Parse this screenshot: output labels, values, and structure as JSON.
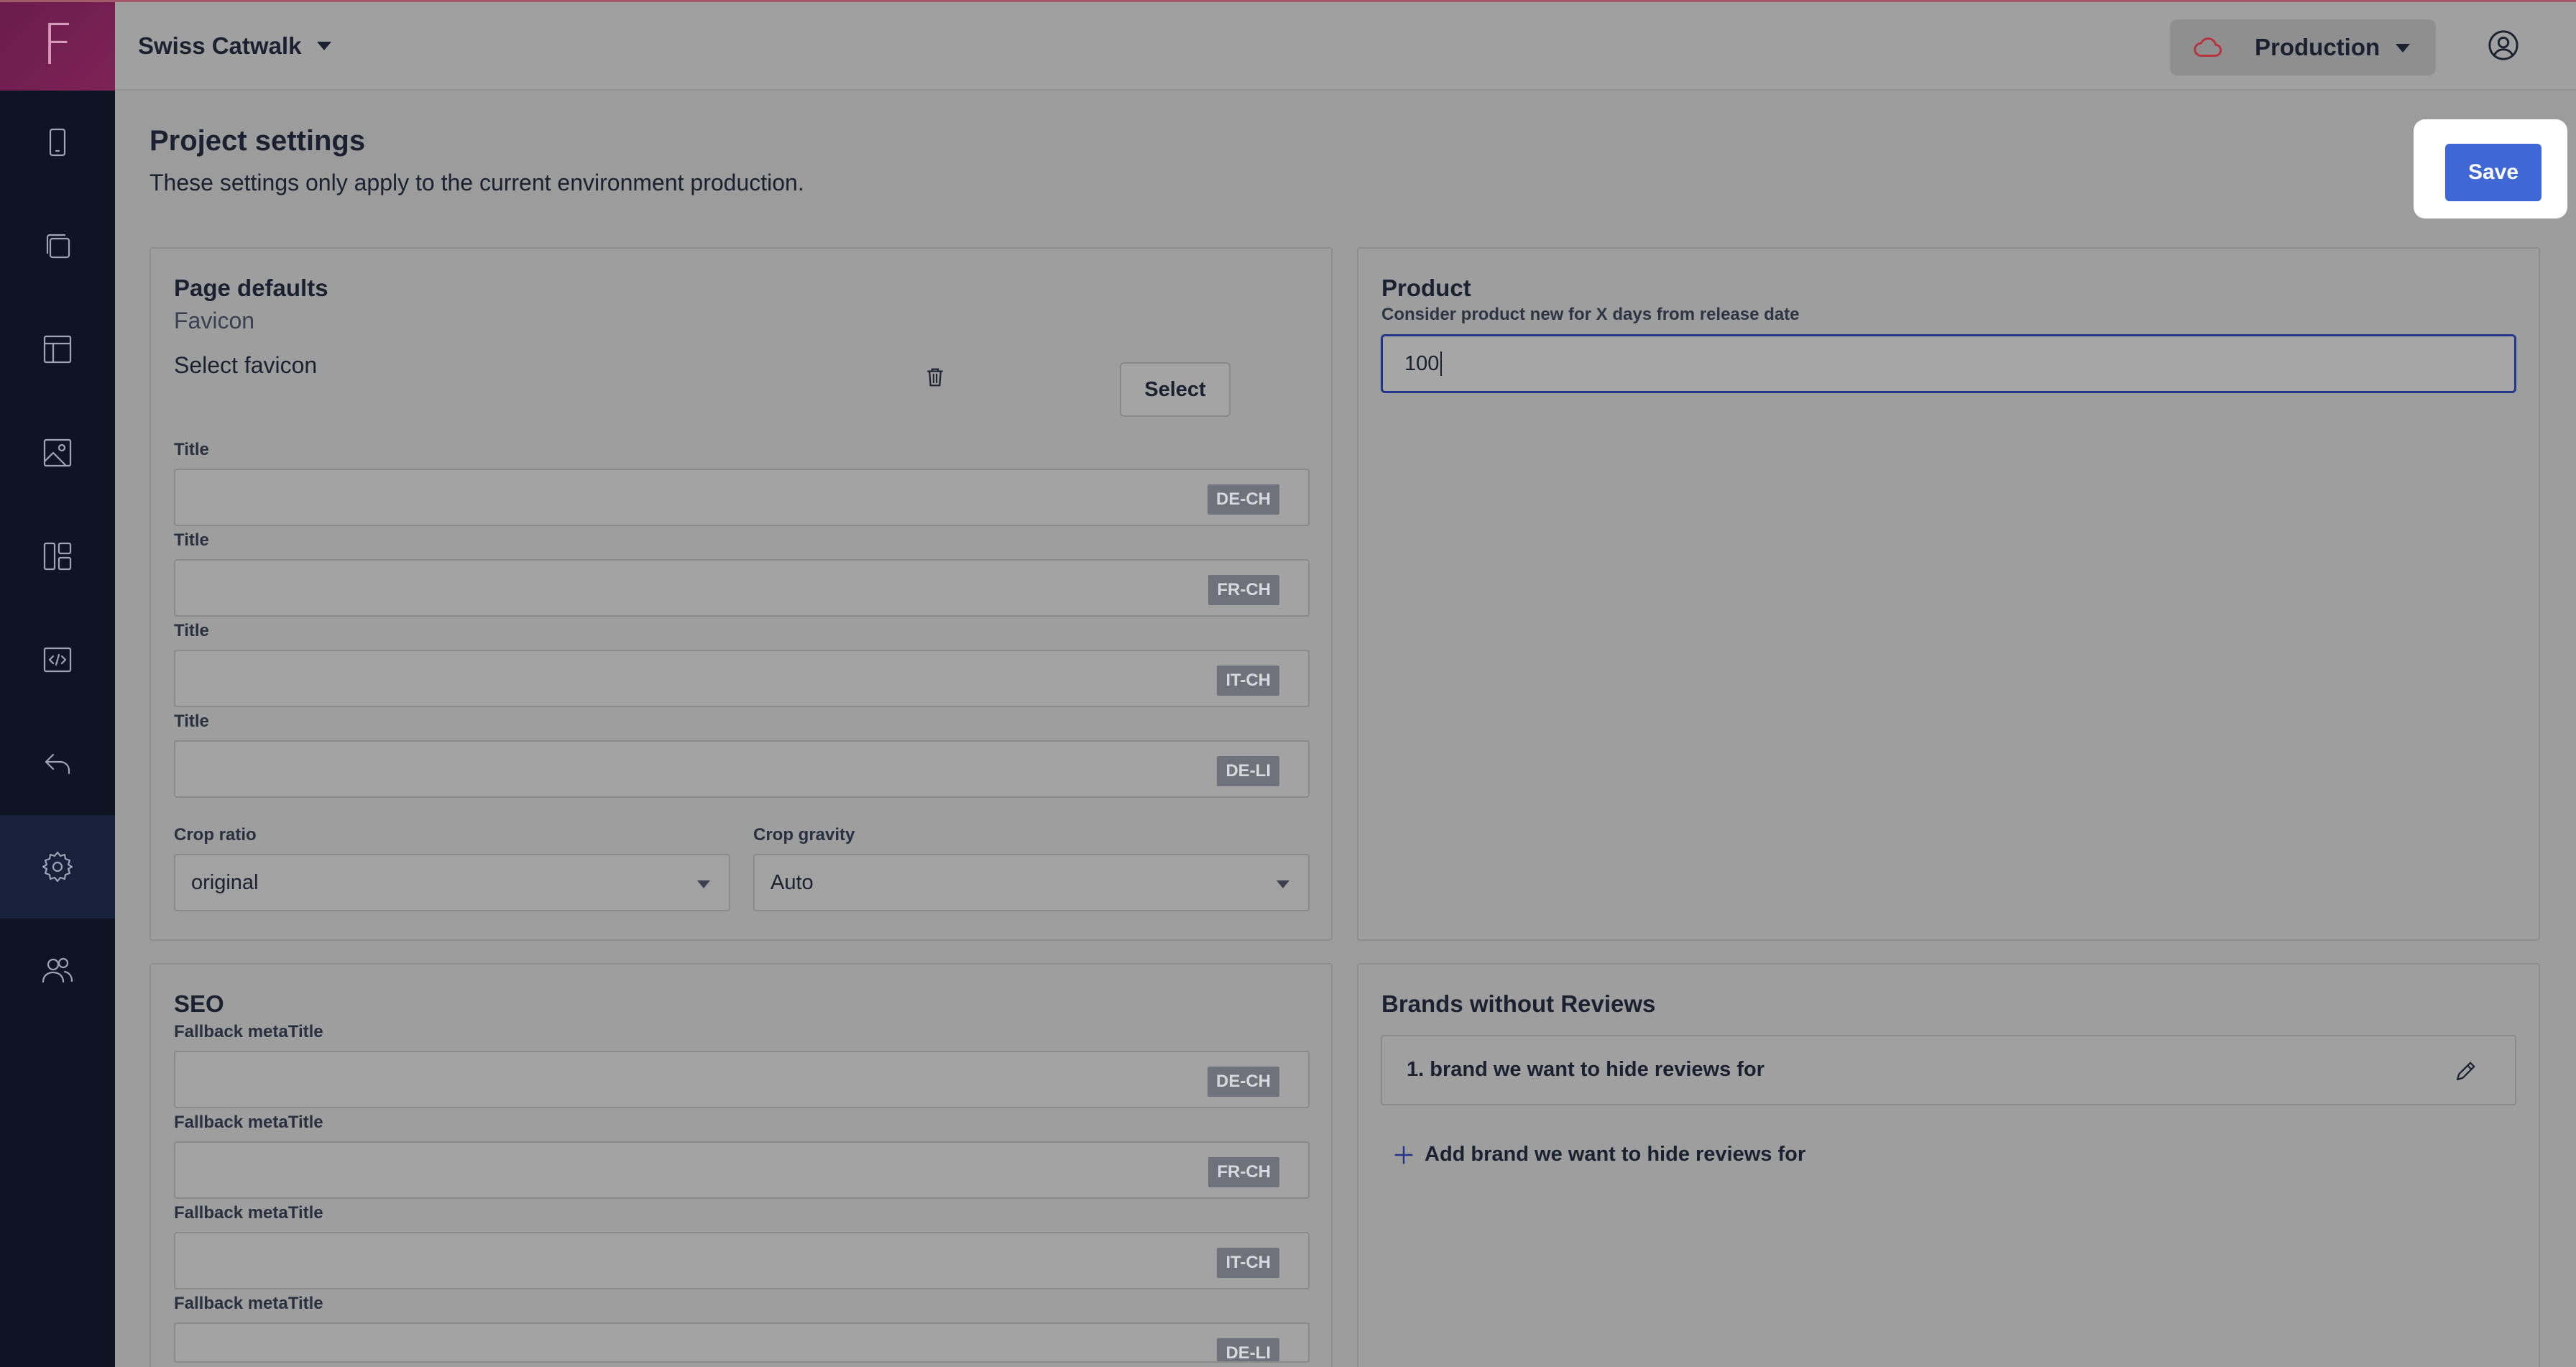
{
  "app": {
    "project_name": "Swiss Catwalk",
    "environment": "Production",
    "logo_letter": "F"
  },
  "sidebar": {
    "items": [
      {
        "icon": "mobile-icon"
      },
      {
        "icon": "pages-icon"
      },
      {
        "icon": "layout-icon"
      },
      {
        "icon": "media-icon"
      },
      {
        "icon": "components-icon"
      },
      {
        "icon": "code-icon"
      },
      {
        "icon": "redirect-icon"
      },
      {
        "icon": "settings-icon",
        "active": true
      },
      {
        "icon": "users-icon"
      }
    ]
  },
  "header": {
    "title": "Project settings",
    "subtitle": "These settings only apply to the current environment production.",
    "save_label": "Save"
  },
  "page_defaults": {
    "title": "Page defaults",
    "favicon_label": "Favicon",
    "favicon_placeholder": "Select favicon",
    "select_label": "Select",
    "title_fields": [
      {
        "label": "Title",
        "locale": "DE-CH",
        "value": ""
      },
      {
        "label": "Title",
        "locale": "FR-CH",
        "value": ""
      },
      {
        "label": "Title",
        "locale": "IT-CH",
        "value": ""
      },
      {
        "label": "Title",
        "locale": "DE-LI",
        "value": ""
      }
    ],
    "crop_ratio_label": "Crop ratio",
    "crop_ratio_value": "original",
    "crop_gravity_label": "Crop gravity",
    "crop_gravity_value": "Auto"
  },
  "product": {
    "title": "Product",
    "new_days_label": "Consider product new for X days from release date",
    "new_days_value": "100"
  },
  "seo": {
    "title": "SEO",
    "fields": [
      {
        "label": "Fallback metaTitle",
        "locale": "DE-CH",
        "value": ""
      },
      {
        "label": "Fallback metaTitle",
        "locale": "FR-CH",
        "value": ""
      },
      {
        "label": "Fallback metaTitle",
        "locale": "IT-CH",
        "value": ""
      },
      {
        "label": "Fallback metaTitle",
        "locale": "DE-LI",
        "value": ""
      }
    ]
  },
  "brands": {
    "title": "Brands without Reviews",
    "items": [
      "1. brand we want to hide reviews for"
    ],
    "add_label": "Add brand we want to hide reviews for"
  },
  "colors": {
    "sidebar_bg": "#0f1424",
    "logo_bg": "#7e2356",
    "primary": "#3f68d6",
    "overlay": "#9e9e9e"
  }
}
